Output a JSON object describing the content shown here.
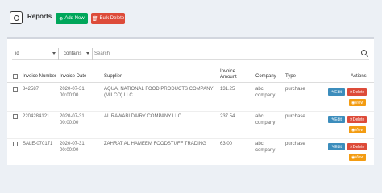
{
  "header": {
    "title": "Reports",
    "add_label": "Add New",
    "bulk_delete_label": "Bulk Delete"
  },
  "filter": {
    "column": "id",
    "operator": "contains",
    "search_placeholder": "Search"
  },
  "table": {
    "columns": [
      "Invoice Number",
      "Invoice Date",
      "Supplier",
      "Invoice Amount",
      "Company",
      "Type",
      "Actions"
    ],
    "rows": [
      {
        "number": "842587",
        "date": "2020-07-31 00:00:00",
        "supplier": "AQUA, NATIONAL FOOD PRODUCTS COMPANY (MILCO) LLC",
        "amount": "131.25",
        "company": "abc company",
        "type": "purchase"
      },
      {
        "number": "2204284121",
        "date": "2020-07-31 00:00:00",
        "supplier": "AL RAWABI DAIRY COMPANY LLC",
        "amount": "237.54",
        "company": "abc company",
        "type": "purchase"
      },
      {
        "number": "SALE-070171",
        "date": "2020-07-31 00:00:00",
        "supplier": "ZAHRAT AL HAMEEM FOODSTUFF TRADING",
        "amount": "63.00",
        "company": "abc company",
        "type": "purchase"
      }
    ],
    "action_labels": {
      "edit": "Edit",
      "delete": "Delete",
      "view": "View"
    }
  }
}
